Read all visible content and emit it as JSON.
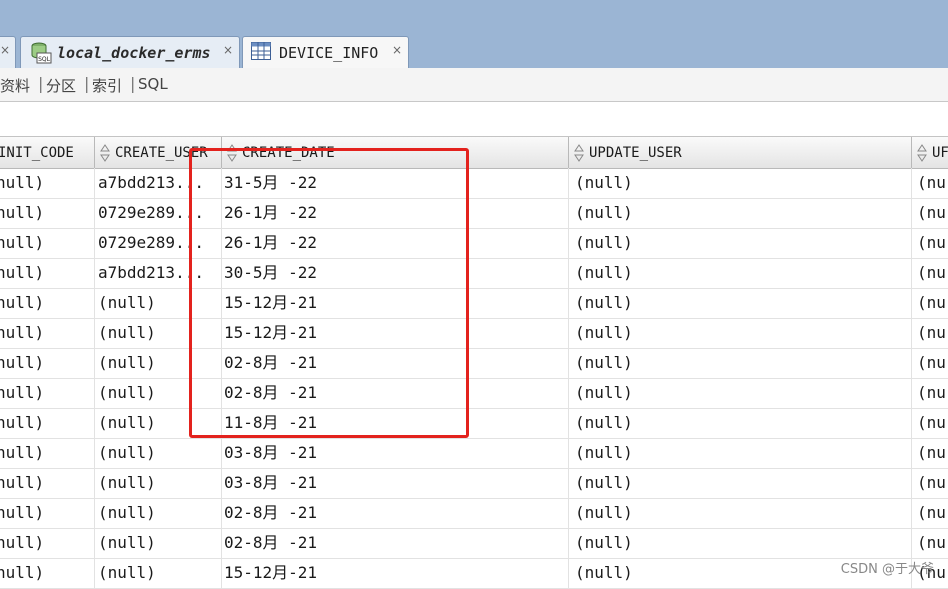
{
  "tabs": [
    {
      "title": "local_docker_erms",
      "close": "×",
      "icon": "sql-database-icon"
    },
    {
      "title": "DEVICE_INFO",
      "close": "×",
      "icon": "table-grid-icon"
    }
  ],
  "partial_tab_close": "×",
  "subtabs": [
    "资料",
    "分区",
    "索引",
    "SQL"
  ],
  "columns": [
    "INIT_CODE",
    "CREATE_USER",
    "CREATE_DATE",
    "UPDATE_USER",
    "UF"
  ],
  "rows": [
    [
      "null)",
      "a7bdd213...",
      "31-5月 -22",
      "(null)",
      "(nu"
    ],
    [
      "null)",
      "0729e289...",
      "26-1月 -22",
      "(null)",
      "(nu"
    ],
    [
      "null)",
      "0729e289...",
      "26-1月 -22",
      "(null)",
      "(nu"
    ],
    [
      "null)",
      "a7bdd213...",
      "30-5月 -22",
      "(null)",
      "(nu"
    ],
    [
      "null)",
      "(null)",
      "15-12月-21",
      "(null)",
      "(nu"
    ],
    [
      "null)",
      "(null)",
      "15-12月-21",
      "(null)",
      "(nu"
    ],
    [
      "null)",
      "(null)",
      "02-8月 -21",
      "(null)",
      "(nu"
    ],
    [
      "null)",
      "(null)",
      "02-8月 -21",
      "(null)",
      "(nu"
    ],
    [
      "null)",
      "(null)",
      "11-8月 -21",
      "(null)",
      "(nu"
    ],
    [
      "null)",
      "(null)",
      "03-8月 -21",
      "(null)",
      "(nu"
    ],
    [
      "null)",
      "(null)",
      "03-8月 -21",
      "(null)",
      "(nu"
    ],
    [
      "null)",
      "(null)",
      "02-8月 -21",
      "(null)",
      "(nu"
    ],
    [
      "null)",
      "(null)",
      "02-8月 -21",
      "(null)",
      "(nu"
    ],
    [
      "null)",
      "(null)",
      "15-12月-21",
      "(null)",
      "(nu"
    ]
  ],
  "watermark": "CSDN @于大爷",
  "colors": {
    "highlight": "#e3221d",
    "tabbar": "#9bb5d4"
  }
}
